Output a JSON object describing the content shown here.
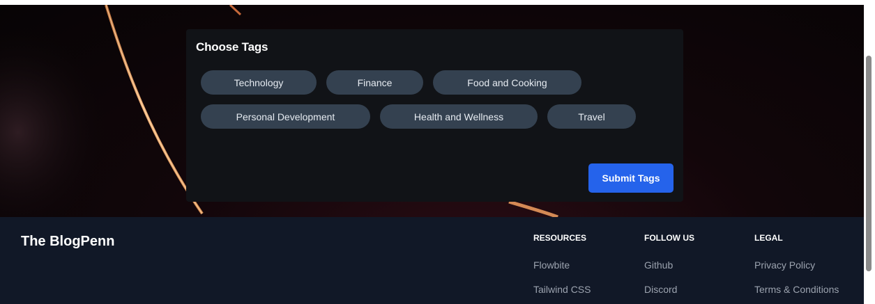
{
  "tags_panel": {
    "title": "Choose Tags",
    "tags": [
      "Technology",
      "Finance",
      "Food and Cooking",
      "Personal Development",
      "Health and Wellness",
      "Travel"
    ],
    "submit_label": "Submit Tags"
  },
  "footer": {
    "brand": "The BlogPenn",
    "columns": [
      {
        "heading": "RESOURCES",
        "links": [
          "Flowbite",
          "Tailwind CSS"
        ]
      },
      {
        "heading": "FOLLOW US",
        "links": [
          "Github",
          "Discord"
        ]
      },
      {
        "heading": "LEGAL",
        "links": [
          "Privacy Policy",
          "Terms & Conditions"
        ]
      }
    ]
  },
  "colors": {
    "accent": "#2563eb",
    "chip_bg": "#344150",
    "card_bg": "#111317",
    "footer_bg": "#111827"
  }
}
